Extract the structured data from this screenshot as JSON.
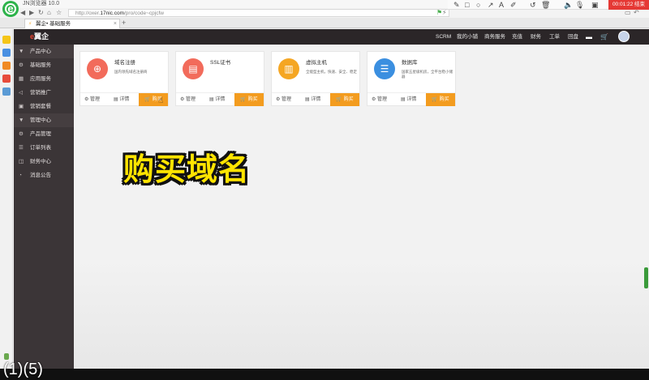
{
  "browser": {
    "title": "JN浏览器 10.0",
    "url_prefix": "http://oxer.",
    "url_domain": "17nic.com",
    "url_path": "/pro/code~cpjcfw",
    "tab_label": "翼企• 基础服务",
    "new_tab": "+",
    "close_tab": "×"
  },
  "recorder": {
    "timer": "00:01:22 结束"
  },
  "app": {
    "logo_text": "翼企",
    "logo_mark": "e",
    "top_nav": [
      "SCRM",
      "我的小铺",
      "商务服务",
      "充值",
      "财务",
      "工单",
      "回盘"
    ]
  },
  "sidebar": {
    "items": [
      {
        "label": "产品中心",
        "icon": "triangle-down-icon",
        "type": "group"
      },
      {
        "label": "基础服务",
        "icon": "gear-icon",
        "type": "item"
      },
      {
        "label": "应用服务",
        "icon": "grid-icon",
        "type": "item"
      },
      {
        "label": "营销推广",
        "icon": "megaphone-icon",
        "type": "item"
      },
      {
        "label": "营销套餐",
        "icon": "package-icon",
        "type": "item"
      },
      {
        "label": "管理中心",
        "icon": "triangle-down-icon",
        "type": "group"
      },
      {
        "label": "产品管理",
        "icon": "gear-icon",
        "type": "item"
      },
      {
        "label": "订单列表",
        "icon": "list-icon",
        "type": "item"
      },
      {
        "label": "财务中心",
        "icon": "wallet-icon",
        "type": "item"
      },
      {
        "label": "消息公告",
        "icon": "bell-icon",
        "type": "item"
      }
    ]
  },
  "cards": [
    {
      "title": "域名注册",
      "desc": "国内领先域名注册商",
      "icon": "globe-icon",
      "color": "#f26b5b",
      "manage": "管理",
      "detail": "详情",
      "buy": "购买"
    },
    {
      "title": "SSL证书",
      "desc": "",
      "icon": "certificate-icon",
      "color": "#f26b5b",
      "manage": "管理",
      "detail": "详情",
      "buy": "购买"
    },
    {
      "title": "虚拟主机",
      "desc": "全能型主机，快速、安全、稳定",
      "icon": "books-icon",
      "color": "#f5a623",
      "manage": "管理",
      "detail": "详情",
      "buy": "购买"
    },
    {
      "title": "数据库",
      "desc": "国家五星级机房，全平台稳小储器",
      "icon": "database-icon",
      "color": "#3b8fe0",
      "manage": "管理",
      "detail": "详情",
      "buy": "购买"
    }
  ],
  "caption": "购买域名",
  "page_label": "(1)(5)"
}
